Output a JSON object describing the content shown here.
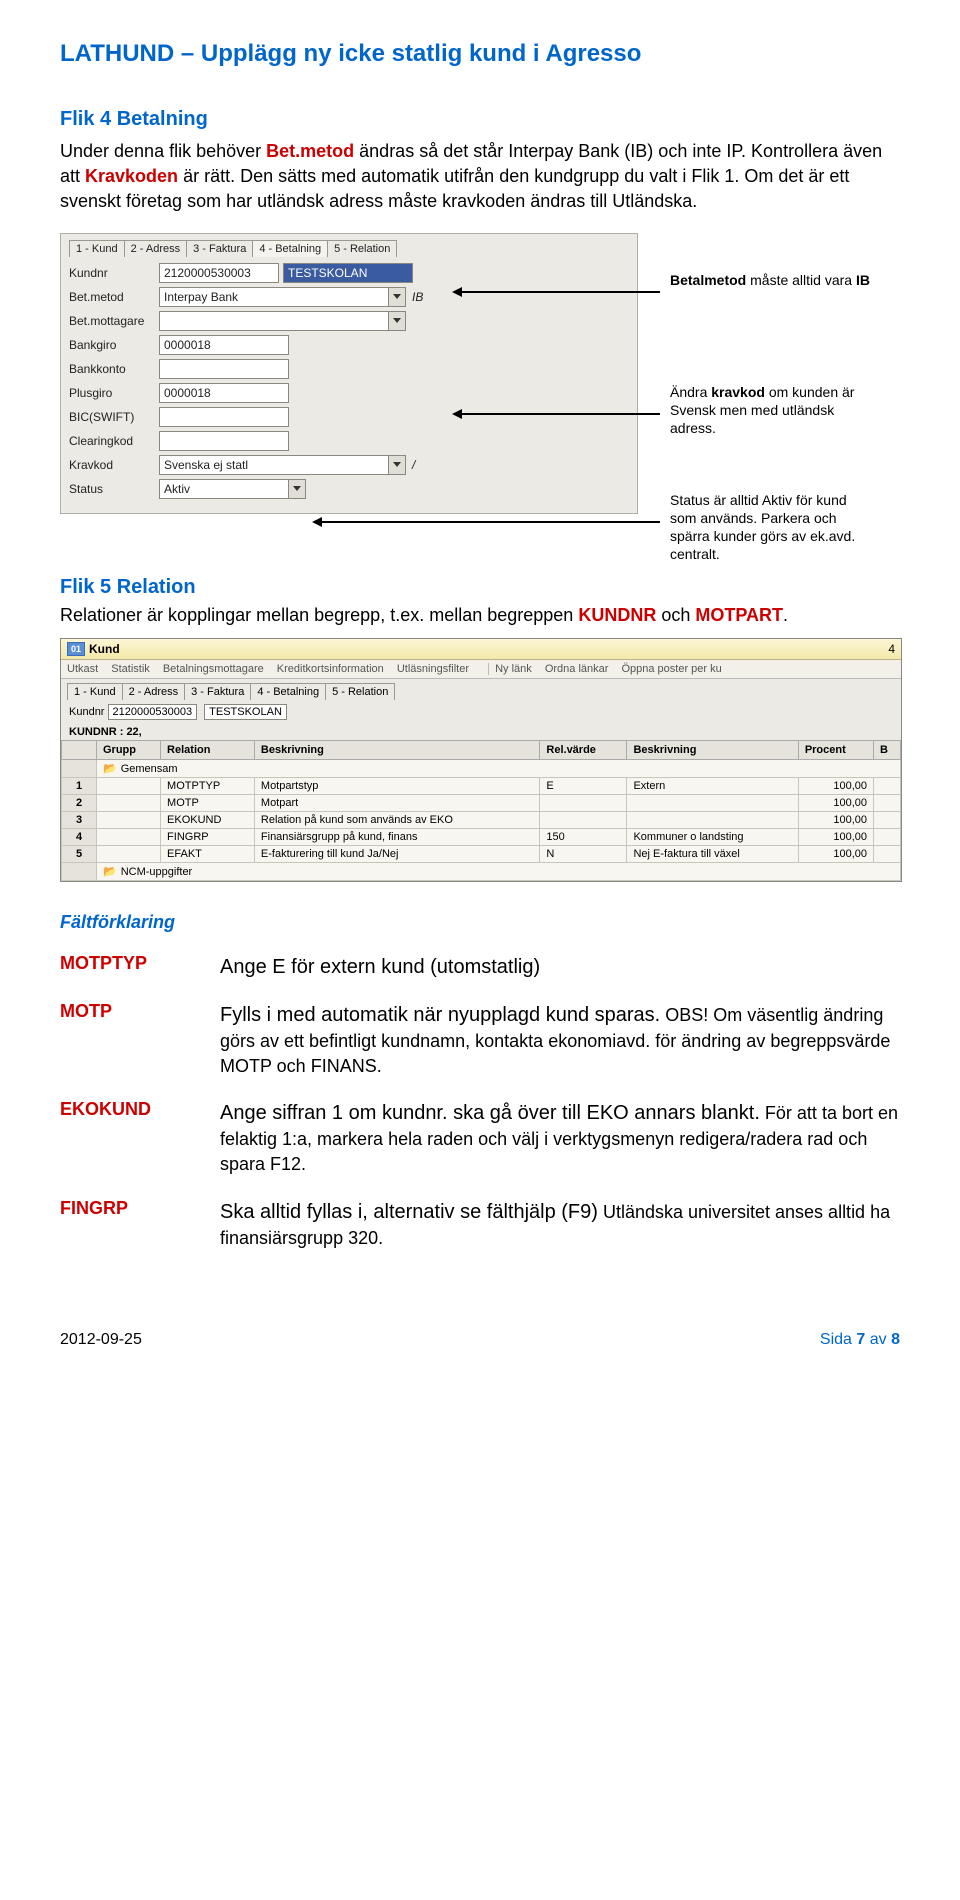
{
  "doc_title": "LATHUND – Upplägg ny icke statlig kund i Agresso",
  "section4": {
    "heading": "Flik 4 Betalning",
    "p1a": "Under denna flik behöver ",
    "p1_red1": "Bet.metod",
    "p1b": " ändras så det står Interpay Bank (IB) och inte IP. Kontrollera även att ",
    "p1_red2": "Kravkoden",
    "p1c": " är rätt. Den sätts med automatik utifrån den kundgrupp du valt i Flik 1. Om det är ett svenskt företag som har utländsk adress måste kravkoden ändras till Utländska."
  },
  "shot1": {
    "tabs": [
      "1 - Kund",
      "2 - Adress",
      "3 - Faktura",
      "4 - Betalning",
      "5 - Relation"
    ],
    "active_tab": 3,
    "labels": {
      "kundnr": "Kundnr",
      "betmetod": "Bet.metod",
      "betmottagare": "Bet.mottagare",
      "bankgiro": "Bankgiro",
      "bankkonto": "Bankkonto",
      "plusgiro": "Plusgiro",
      "bicswift": "BIC(SWIFT)",
      "clearingkod": "Clearingkod",
      "kravkod": "Kravkod",
      "status": "Status"
    },
    "values": {
      "kundnr": "2120000530003",
      "kundnamn": "TESTSKOLAN",
      "betmetod": "Interpay Bank",
      "betmetod_code": "IB",
      "bankgiro": "0000018",
      "plusgiro": "0000018",
      "kravkod": "Svenska ej statl",
      "kravkod_code": "/",
      "status": "Aktiv"
    }
  },
  "callouts": {
    "c1a": "Betalmetod",
    "c1b": " måste alltid vara ",
    "c1c": "IB",
    "c2a": "Ändra ",
    "c2b": "kravkod",
    "c2c": " om kunden är Svensk men med utländsk adress.",
    "c3": "Status är alltid Aktiv för kund som används. Parkera och spärra kunder görs av ek.avd. centralt."
  },
  "section5": {
    "heading": "Flik 5 Relation",
    "p1a": "Relationer är kopplingar mellan begrepp, t.ex. mellan begreppen ",
    "p1_red1": "KUNDNR",
    "p1b": " och ",
    "p1_red2": "MOTPART",
    "p1c": "."
  },
  "shot2": {
    "title": "Kund",
    "scroll_num": "4",
    "toolbar": [
      "Utkast",
      "Statistik",
      "Betalningsmottagare",
      "Kreditkortsinformation",
      "Utläsningsfilter",
      "Ny länk",
      "Ordna länkar",
      "Öppna poster per ku"
    ],
    "tabs": [
      "1 - Kund",
      "2 - Adress",
      "3 - Faktura",
      "4 - Betalning",
      "5 - Relation"
    ],
    "kundnr_label": "Kundnr",
    "kundnr": "2120000530003",
    "kundnamn": "TESTSKOLAN",
    "kline": "KUNDNR : 22,",
    "cols": [
      "",
      "Grupp",
      "Relation",
      "Beskrivning",
      "Rel.värde",
      "Beskrivning",
      "Procent",
      "B"
    ],
    "gemensam": "Gemensam",
    "rows": [
      {
        "n": "1",
        "rel": "MOTPTYP",
        "besk": "Motpartstyp",
        "val": "E",
        "besk2": "Extern",
        "pct": "100,00"
      },
      {
        "n": "2",
        "rel": "MOTP",
        "besk": "Motpart",
        "val": "",
        "besk2": "",
        "pct": "100,00"
      },
      {
        "n": "3",
        "rel": "EKOKUND",
        "besk": "Relation på kund som används av EKO",
        "val": "",
        "besk2": "",
        "pct": "100,00"
      },
      {
        "n": "4",
        "rel": "FINGRP",
        "besk": "Finansiärsgrupp på kund, finans",
        "val": "150",
        "besk2": "Kommuner o landsting",
        "pct": "100,00"
      },
      {
        "n": "5",
        "rel": "EFAKT",
        "besk": "E-fakturering till kund Ja/Nej",
        "val": "N",
        "besk2": "Nej E-faktura till växel",
        "pct": "100,00"
      }
    ],
    "ncm": "NCM-uppgifter"
  },
  "field_heading": "Fältförklaring",
  "defs": {
    "motptyp": {
      "term": "MOTPTYP",
      "lead": "Ange E för extern kund (utomstatlig)"
    },
    "motp": {
      "term": "MOTP",
      "lead": "Fylls i med automatik när nyupplagd kund sparas.",
      "rest": " OBS! Om väsentlig ändring görs av ett befintligt kundnamn, kontakta ekonomiavd. för ändring av begreppsvärde MOTP och FINANS."
    },
    "ekokund": {
      "term": "EKOKUND",
      "lead": "Ange siffran 1 om kundnr. ska gå över till EKO annars blankt.",
      "rest": " För att ta bort en felaktig 1:a, markera hela raden och välj i verktygsmenyn redigera/radera rad och spara F12."
    },
    "fingrp": {
      "term": "FINGRP",
      "lead": "Ska alltid fyllas i, alternativ se fälthjälp (F9)",
      "rest": " Utländska universitet anses alltid ha finansiärsgrupp 320."
    }
  },
  "footer": {
    "left": "2012-09-25",
    "right_a": "Sida ",
    "right_b": "7",
    "right_c": " av ",
    "right_d": "8"
  }
}
